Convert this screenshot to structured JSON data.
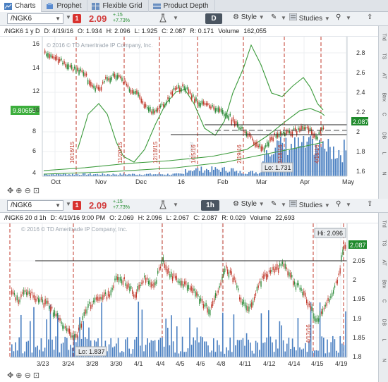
{
  "tabs": [
    {
      "label": "Charts",
      "icon": "chart-icon",
      "active": true
    },
    {
      "label": "Prophet",
      "icon": "prophet-icon"
    },
    {
      "label": "Flexible Grid",
      "icon": "grid-icon"
    },
    {
      "label": "Product Depth",
      "icon": "depth-icon"
    }
  ],
  "top": {
    "symbol": "/NGK6",
    "badge": "1",
    "price": "2.09",
    "change1": "+.15",
    "change2": "+7.73%",
    "period": "D",
    "style_label": "Style",
    "studies_label": "Studies",
    "info": {
      "sym": "/NGK6 1 y D",
      "d": "D: 4/19/16",
      "o": "O: 1.934",
      "h": "H: 2.096",
      "l": "L: 1.925",
      "c": "C: 2.087",
      "r": "R: 0.171",
      "volume_label": "Volume",
      "volume": "162,055"
    },
    "watermark": "© 2016 © TD Ameritrade IP Company, Inc.",
    "left_value": "9.80655",
    "last_price_tag": "2.087",
    "low_label": "Lo: 1.731",
    "event_labels": [
      "10/16/15",
      "11/20/15",
      "12/18/15",
      "1/15/16",
      "2/19/16",
      "3/18/16",
      "4/15/16"
    ],
    "faded_label": "/15 year",
    "x_labels": [
      "Oct",
      "Nov",
      "Dec",
      "16",
      "Feb",
      "Mar",
      "Apr",
      "May"
    ],
    "left_axis": [
      "16",
      "14",
      "12",
      "10",
      "8",
      "6",
      "4"
    ],
    "right_axis": [
      "2.8",
      "2.6",
      "2.4",
      "2.2",
      "2",
      "1.8",
      "1.6"
    ],
    "sidebar": [
      "Trd",
      "TS",
      "AT",
      "Btrx",
      "C",
      "DB",
      "L",
      "N"
    ]
  },
  "bottom": {
    "symbol": "/NGK6",
    "badge": "1",
    "price": "2.09",
    "change1": "+.15",
    "change2": "+7.73%",
    "period": "1h",
    "style_label": "Style",
    "studies_label": "Studies",
    "info": {
      "sym": "/NGK6 20 d 1h",
      "d": "D: 4/19/16 9:00 PM",
      "o": "O: 2.069",
      "h": "H: 2.096",
      "l": "L: 2.067",
      "c": "C: 2.087",
      "r": "R: 0.029",
      "volume_label": "Volume",
      "volume": "22,693"
    },
    "watermark": "© 2016 © TD Ameritrade IP Company, Inc.",
    "high_label": "Hi: 2.096",
    "low_label": "Lo: 1.837",
    "last_price_tag": "2.087",
    "event_label": "4/13/16",
    "x_labels": [
      "3/23",
      "3/24",
      "3/28",
      "3/30",
      "4/1",
      "4/4",
      "4/5",
      "4/6",
      "4/8",
      "4/11",
      "4/12",
      "4/14",
      "4/15",
      "4/19"
    ],
    "right_axis": [
      "2.05",
      "2",
      "1.95",
      "1.9",
      "1.85",
      "1.8"
    ],
    "sidebar": [
      "Trd",
      "TS",
      "AT",
      "Btrx",
      "C",
      "DB",
      "L",
      "N"
    ]
  },
  "colors": {
    "up": "#2e8b3a",
    "down": "#c0392b",
    "volume": "#4a7fc1",
    "ma": "#3a9a3a",
    "event_line": "#c0392b",
    "price_tag": "#1f8a2c",
    "left_tag": "#3cae3c"
  }
}
